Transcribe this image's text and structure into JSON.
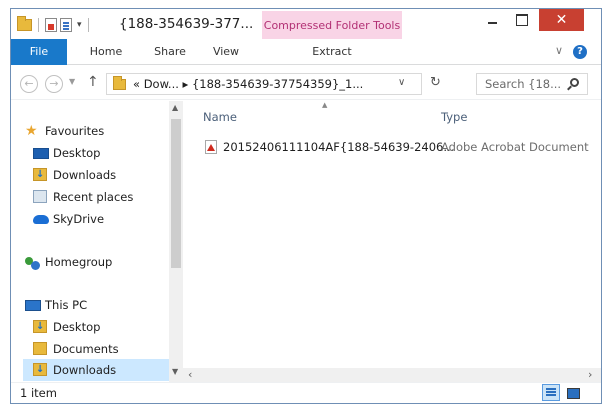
{
  "window": {
    "title": "{188-354639-377...",
    "contextual_tab_group": "Compressed Folder Tools",
    "close_glyph": "✕"
  },
  "ribbon": {
    "tabs": [
      {
        "label": "File"
      },
      {
        "label": "Home"
      },
      {
        "label": "Share"
      },
      {
        "label": "View"
      },
      {
        "label": "Extract"
      }
    ],
    "help_glyph": "?"
  },
  "address": {
    "crumbs": "« Dow... ▸ {188-354639-37754359}_1...",
    "search_placeholder": "Search {18..."
  },
  "navpane": {
    "favourites": "Favourites",
    "items_fav": [
      {
        "label": "Desktop"
      },
      {
        "label": "Downloads"
      },
      {
        "label": "Recent places"
      },
      {
        "label": "SkyDrive"
      }
    ],
    "homegroup": "Homegroup",
    "this_pc": "This PC",
    "items_pc": [
      {
        "label": "Desktop"
      },
      {
        "label": "Documents"
      },
      {
        "label": "Downloads"
      }
    ]
  },
  "filelist": {
    "columns": {
      "name": "Name",
      "type": "Type"
    },
    "rows": [
      {
        "name": "20152406111104AF{188-54639-2406...",
        "type": "Adobe Acrobat Document"
      }
    ]
  },
  "status": {
    "count": "1 item"
  },
  "colors": {
    "file_tab": "#1979ca",
    "close_button": "#c84031",
    "context_tab": "#f9d4e6",
    "selection": "#cce8ff"
  }
}
